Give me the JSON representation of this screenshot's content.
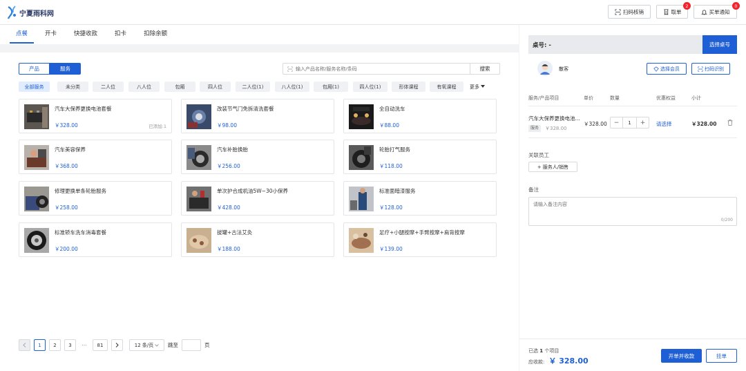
{
  "header": {
    "logo_text": "宁夏雨科网",
    "scan_verify_label": "扫码核销",
    "pickup_label": "取单",
    "pickup_badge": "2",
    "notify_label": "买单通知",
    "notify_badge": "0"
  },
  "tabs": [
    {
      "label": "点餐",
      "active": true
    },
    {
      "label": "开卡"
    },
    {
      "label": "快捷收款"
    },
    {
      "label": "扣卡"
    },
    {
      "label": "扣除余额"
    }
  ],
  "toggle": {
    "product_label": "产品",
    "service_label": "服务",
    "selected": "服务"
  },
  "search": {
    "placeholder": "输入产品名称/服务名称/条码",
    "button_label": "搜索"
  },
  "categories": [
    "全部服务",
    "未分类",
    "二人位",
    "八人位",
    "包厢",
    "四人位",
    "二人位(1)",
    "八人位(1)",
    "包厢(1)",
    "四人位(1)",
    "形体课程",
    "有氧课程"
  ],
  "more_label": "更多",
  "products": [
    {
      "name": "汽车大保养更换电池套餐",
      "price": "￥328.00",
      "added": "已添加:1"
    },
    {
      "name": "改装节气门免拆清洗套餐",
      "price": "￥98.00",
      "added": ""
    },
    {
      "name": "全自动洗车",
      "price": "￥88.00",
      "added": ""
    },
    {
      "name": "汽车美容保养",
      "price": "￥368.00",
      "added": ""
    },
    {
      "name": "汽车补胎换胎",
      "price": "￥256.00",
      "added": ""
    },
    {
      "name": "轮胎打气服务",
      "price": "￥118.00",
      "added": ""
    },
    {
      "name": "修理更换单条轮胎服务",
      "price": "￥258.00",
      "added": ""
    },
    {
      "name": "单次护合成机油5W~30小保养",
      "price": "￥428.00",
      "added": ""
    },
    {
      "name": "标准面暗漆服务",
      "price": "￥128.00",
      "added": ""
    },
    {
      "name": "标准轿车洗车消毒套餐",
      "price": "￥200.00",
      "added": ""
    },
    {
      "name": "拔罐+古法艾灸",
      "price": "￥188.00",
      "added": ""
    },
    {
      "name": "足疗+小腿按摩+手臂按摩+肩背按摩",
      "price": "￥139.00",
      "added": ""
    }
  ],
  "pagination": {
    "pages": [
      "1",
      "2",
      "3",
      "···",
      "81"
    ],
    "current": "1",
    "page_size": "12 条/页",
    "goto_label": "跳至",
    "page_label": "页"
  },
  "order": {
    "table_label": "桌号: -",
    "select_table_label": "选择桌号",
    "member_name": "散客",
    "select_member_label": "选择会员",
    "scan_label": "扫码识别",
    "columns": [
      "服务/产品项目",
      "单价",
      "数量",
      "优惠权益",
      "小计"
    ],
    "item": {
      "name": "汽车大保养更换电池...",
      "tag": "服务",
      "orig_price": "￥328.00",
      "unit_price": "￥328.00",
      "qty": "1",
      "discount": "请选择",
      "subtotal": "￥328.00"
    },
    "staff_label": "关联员工",
    "staff_button": "服务人/销售",
    "remark_label": "备注",
    "remark_placeholder": "请输入备注内容",
    "remark_count": "0/200",
    "selected_prefix": "已选",
    "selected_count": "1",
    "selected_suffix": "个项目",
    "due_label": "应收款:",
    "due_amount": "￥ 328.00",
    "pay_button": "开单并收款",
    "hang_button": "挂单"
  },
  "colors": {
    "accent": "#1e5fd6",
    "badge": "#f5222d"
  }
}
